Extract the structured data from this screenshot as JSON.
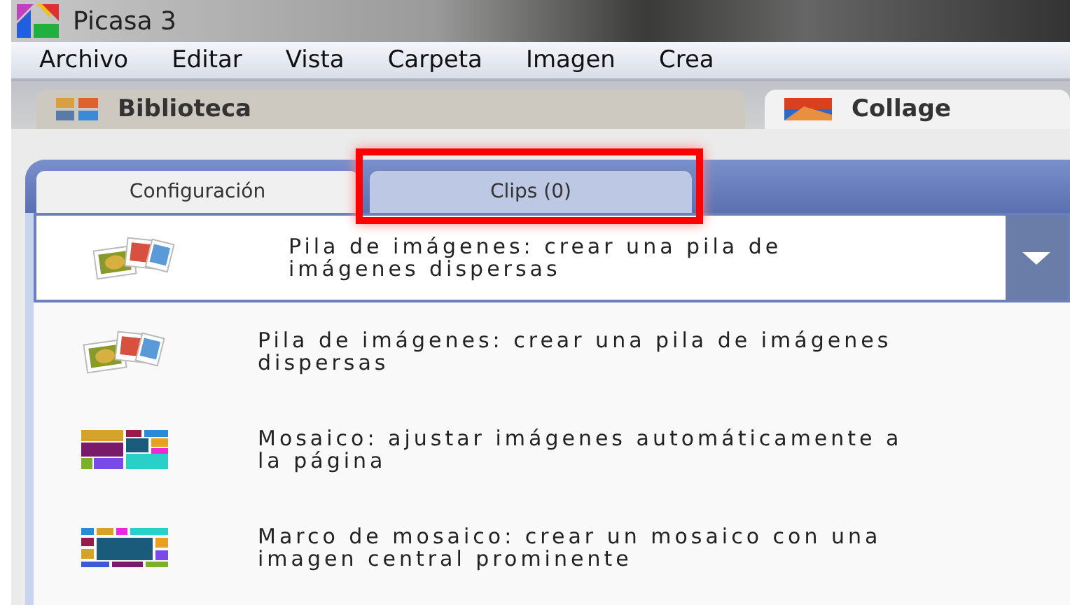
{
  "window": {
    "title": "Picasa 3"
  },
  "menu": [
    "Archivo",
    "Editar",
    "Vista",
    "Carpeta",
    "Imagen",
    "Crea"
  ],
  "view_tabs": [
    {
      "label": "Biblioteca",
      "selected": false,
      "kind": "library"
    },
    {
      "label": "Collage",
      "selected": true,
      "kind": "collage"
    }
  ],
  "panel_tabs": [
    {
      "label": "Configuración",
      "selected": true,
      "highlighted": false
    },
    {
      "label": "Clips (0)",
      "selected": false,
      "highlighted": true
    }
  ],
  "dropdown": {
    "value": "Pila de imágenes: crear una pila de imágenes dispersas",
    "kind": "stack",
    "expanded": true
  },
  "options": [
    {
      "label": "Pila de imágenes: crear una pila de imágenes dispersas",
      "kind": "stack"
    },
    {
      "label": "Mosaico: ajustar imágenes automáticamente a la página",
      "kind": "mosaic"
    },
    {
      "label": "Marco de mosaico: crear un mosaico con una imagen central prominente",
      "kind": "frame"
    }
  ]
}
